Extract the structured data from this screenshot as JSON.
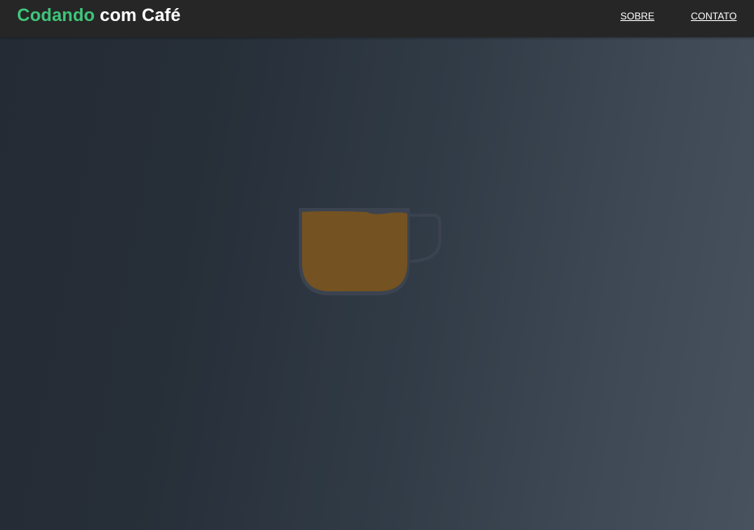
{
  "header": {
    "brand_accent": "Codando",
    "brand_rest": " com Café",
    "nav": [
      {
        "label": "SOBRE"
      },
      {
        "label": "CONTATO"
      }
    ]
  },
  "hero": {
    "icon": "coffee-cup-icon"
  },
  "colors": {
    "brand_accent": "#3fc57a",
    "navbar_bg": "#262626",
    "coffee": "#745221",
    "cup_outline": "#3c4350",
    "bg_left": "#252b35",
    "bg_right": "#47525e"
  }
}
